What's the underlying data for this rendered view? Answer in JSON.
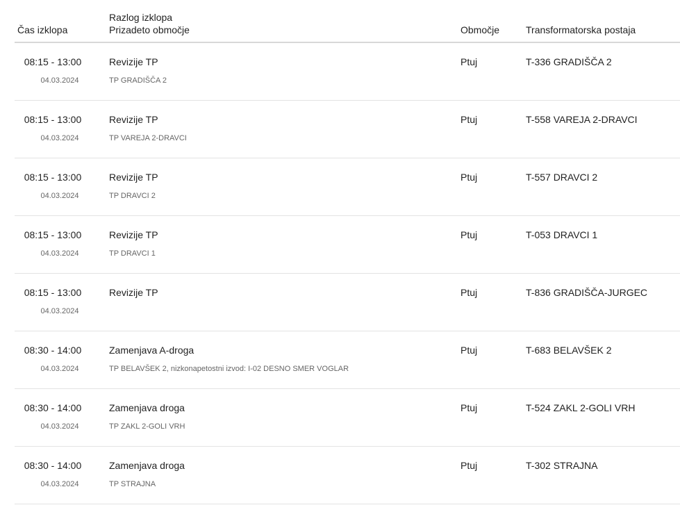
{
  "header": {
    "time": "Čas izklopa",
    "reason": "Razlog izklopa",
    "affected": "Prizadeto območje",
    "area": "Območje",
    "station": "Transformatorska postaja"
  },
  "rows": [
    {
      "time": "08:15 - 13:00",
      "date": "04.03.2024",
      "reason": "Revizije TP",
      "affected": "TP GRADIŠČA 2",
      "area": "Ptuj",
      "station": "T-336 GRADIŠČA 2"
    },
    {
      "time": "08:15 - 13:00",
      "date": "04.03.2024",
      "reason": "Revizije TP",
      "affected": "TP VAREJA 2-DRAVCI",
      "area": "Ptuj",
      "station": "T-558 VAREJA 2-DRAVCI"
    },
    {
      "time": "08:15 - 13:00",
      "date": "04.03.2024",
      "reason": "Revizije TP",
      "affected": "TP DRAVCI 2",
      "area": "Ptuj",
      "station": "T-557 DRAVCI 2"
    },
    {
      "time": "08:15 - 13:00",
      "date": "04.03.2024",
      "reason": "Revizije TP",
      "affected": "TP DRAVCI 1",
      "area": "Ptuj",
      "station": "T-053 DRAVCI 1"
    },
    {
      "time": "08:15 - 13:00",
      "date": "04.03.2024",
      "reason": "Revizije TP",
      "affected": "",
      "area": "Ptuj",
      "station": "T-836 GRADIŠČA-JURGEC"
    },
    {
      "time": "08:30 - 14:00",
      "date": "04.03.2024",
      "reason": "Zamenjava A-droga",
      "affected": "TP BELAVŠEK 2, nizkonapetostni izvod: I-02 DESNO SMER VOGLAR",
      "area": "Ptuj",
      "station": "T-683 BELAVŠEK 2"
    },
    {
      "time": "08:30 - 14:00",
      "date": "04.03.2024",
      "reason": "Zamenjava droga",
      "affected": "TP ZAKL 2-GOLI VRH",
      "area": "Ptuj",
      "station": "T-524 ZAKL 2-GOLI VRH"
    },
    {
      "time": "08:30 - 14:00",
      "date": "04.03.2024",
      "reason": "Zamenjava droga",
      "affected": "TP STRAJNA",
      "area": "Ptuj",
      "station": "T-302 STRAJNA"
    }
  ]
}
